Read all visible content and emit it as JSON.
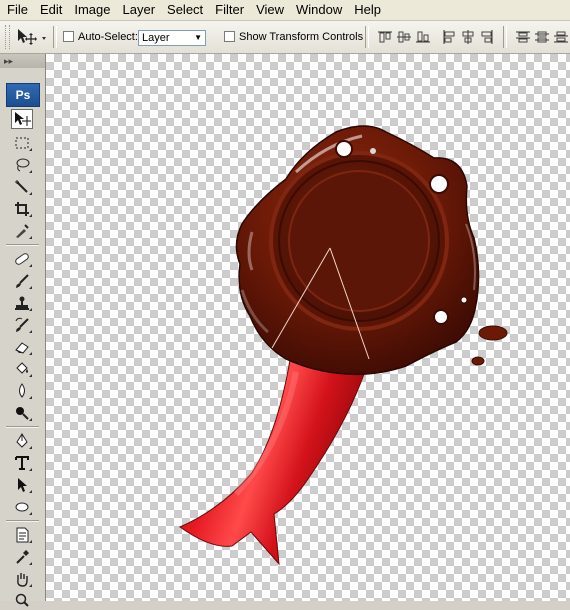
{
  "menu": [
    "File",
    "Edit",
    "Image",
    "Layer",
    "Select",
    "Filter",
    "View",
    "Window",
    "Help"
  ],
  "options": {
    "auto_select_label": "Auto-Select:",
    "auto_select_checked": false,
    "auto_select_target": "Layer",
    "transform_label": "Show Transform Controls",
    "transform_checked": false
  },
  "tools": {
    "logo": "Ps",
    "active": "move-tool",
    "items": [
      "move-tool",
      "marquee-tool",
      "lasso-tool",
      "magic-wand-tool",
      "crop-tool",
      "eyedropper-tool",
      "healing-brush-tool",
      "brush-tool",
      "clone-stamp-tool",
      "history-brush-tool",
      "eraser-tool",
      "paint-bucket-tool",
      "blur-tool",
      "dodge-tool",
      "pen-tool",
      "type-tool",
      "path-selection-tool",
      "shape-tool",
      "notes-tool",
      "eyedropper-tool-2",
      "hand-tool",
      "zoom-tool"
    ]
  },
  "canvas": {
    "background": "transparency-checkerboard",
    "seal_color": "#5e1406",
    "ribbon_color": "#e3121b"
  }
}
